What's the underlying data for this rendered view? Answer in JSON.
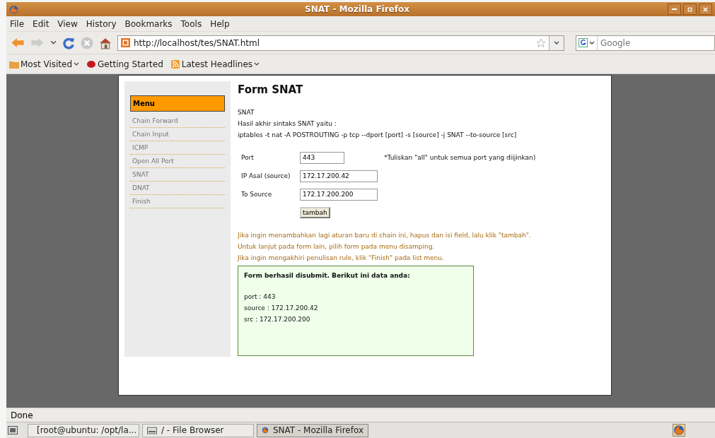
{
  "window": {
    "title": "SNAT - Mozilla Firefox"
  },
  "menu_bar": [
    "File",
    "Edit",
    "View",
    "History",
    "Bookmarks",
    "Tools",
    "Help"
  ],
  "address_bar": {
    "value": "http://localhost/tes/SNAT.html"
  },
  "search": {
    "placeholder": "Google"
  },
  "bookmarks": [
    {
      "label": "Most Visited",
      "kind": "folder"
    },
    {
      "label": "Getting Started",
      "kind": "page"
    },
    {
      "label": "Latest Headlines",
      "kind": "feed"
    }
  ],
  "page": {
    "sidebar": {
      "title": "Menu",
      "items": [
        "Chain Forward",
        "Chain Input",
        "ICMP",
        "Open All Port",
        "SNAT",
        "DNAT",
        "Finish"
      ]
    },
    "heading": "Form SNAT",
    "intro": [
      "SNAT",
      "Hasil akhir sintaks SNAT yaitu :",
      "iptables -t nat -A POSTROUTING -p tcp --dport [port] -s [source] -j SNAT --to-source [src]"
    ],
    "fields": [
      {
        "label": "Port",
        "value": "443",
        "hint": "*Tuliskan \"all\" untuk semua port yang diijinkan)",
        "kind": "short"
      },
      {
        "label": "IP Asal (source)",
        "value": "172.17.200.42",
        "kind": "long"
      },
      {
        "label": "To Source",
        "value": "172.17.200.200",
        "kind": "long"
      }
    ],
    "submit_button": "tambah",
    "notes": [
      "Jika ingin menambahkan lagi aturan baru di chain ini, hapus dan isi field, lalu klik \"tambah\".",
      "Untuk lanjut pada form lain, pilih form pada menu disamping.",
      "Jika ingin mengakhiri penulisan rule, klik \"Finish\" pada list menu."
    ],
    "result": {
      "title": "Form berhasil disubmit. Berikut ini data anda:",
      "lines": [
        "port : 443",
        "source : 172.17.200.42",
        "src : 172.17.200.200"
      ]
    }
  },
  "status_bar": "Done",
  "taskbar": [
    {
      "label": "[root@ubuntu: /opt/la...",
      "kind": "terminal",
      "selected": false
    },
    {
      "label": "/ - File Browser",
      "kind": "files",
      "selected": false
    },
    {
      "label": "SNAT - Mozilla Firefox",
      "kind": "browser",
      "selected": true
    }
  ]
}
